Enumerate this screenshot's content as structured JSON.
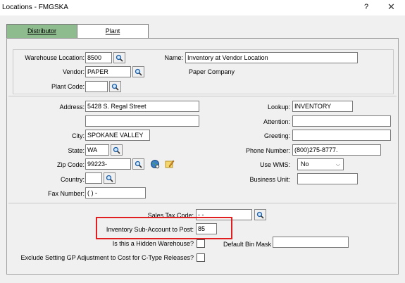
{
  "window": {
    "title": "Locations - FMGSKA",
    "help": "?",
    "close": "✕"
  },
  "tabs": [
    {
      "label": "Distributor",
      "active": true
    },
    {
      "label": "Plant",
      "active": false
    }
  ],
  "location": {
    "warehouse_label": "Warehouse Location:",
    "warehouse_value": "8500",
    "name_label": "Name:",
    "name_value": "Inventory at Vendor Location",
    "vendor_label": "Vendor:",
    "vendor_value": "PAPER",
    "vendor_name": "Paper Company",
    "plant_code_label": "Plant Code:",
    "plant_code_value": ""
  },
  "address": {
    "address_label": "Address:",
    "address1": "5428 S. Regal Street",
    "address2": "",
    "city_label": "City:",
    "city_value": "SPOKANE VALLEY",
    "state_label": "State:",
    "state_value": "WA",
    "zip_label": "Zip Code:",
    "zip_value": "99223-",
    "country_label": "Country:",
    "country_value": "",
    "fax_label": "Fax Number:",
    "fax_value": "(  )   -",
    "lookup_label": "Lookup:",
    "lookup_value": "INVENTORY",
    "attention_label": "Attention:",
    "attention_value": "",
    "greeting_label": "Greeting:",
    "greeting_value": "",
    "phone_label": "Phone Number:",
    "phone_value": "(800)275-8777.",
    "wms_label": "Use WMS:",
    "wms_value": "No",
    "business_unit_label": "Business Unit:",
    "business_unit_value": ""
  },
  "settings": {
    "sales_tax_label": "Sales Tax Code:",
    "sales_tax_value": "  -    -",
    "subaccount_label": "Inventory Sub-Account to Post:",
    "subaccount_value": "85",
    "hidden_label": "Is this a Hidden Warehouse?",
    "hidden_checked": false,
    "default_bin_label": "Default Bin Mask",
    "default_bin_value": "",
    "exclude_label": "Exclude Setting GP Adjustment to Cost for C-Type Releases?",
    "exclude_checked": false
  },
  "colors": {
    "active_tab": "#8fbc8f",
    "highlight": "#e02020"
  }
}
